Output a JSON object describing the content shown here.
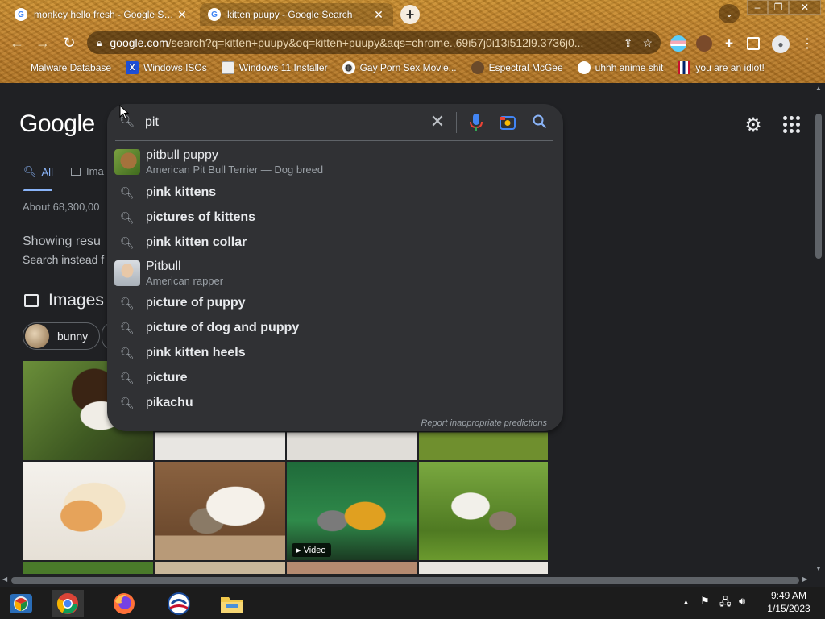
{
  "browser": {
    "tabs": [
      {
        "title": "monkey hello fresh - Google Search",
        "active": false
      },
      {
        "title": "kitten puupy - Google Search",
        "active": true
      }
    ],
    "url_host": "google.com",
    "url_rest": "/search?q=kitten+puupy&oq=kitten+puupy&aqs=chrome..69i57j0i13i512l9.3736j0...",
    "bookmarks": [
      {
        "label": "Malware Database",
        "icon": "none"
      },
      {
        "label": "Windows ISOs",
        "icon": "x-logo"
      },
      {
        "label": "Windows 11 Installer",
        "icon": "picture"
      },
      {
        "label": "Gay Porn Sex Movie...",
        "icon": "globe"
      },
      {
        "label": "Espectral McGee",
        "icon": "avatar"
      },
      {
        "label": "uhhh anime shit",
        "icon": "avatar"
      },
      {
        "label": "you are an idiot!",
        "icon": "flag"
      }
    ]
  },
  "page": {
    "logo": "Google",
    "tabs": {
      "all": "All",
      "images": "Ima"
    },
    "results_count": "About 68,300,00",
    "showing": "Showing resu",
    "search_instead": "Search instead f",
    "images_heading": "Images",
    "chip": "bunny",
    "video_label": "Video"
  },
  "search": {
    "value": "pit",
    "report_link": "Report inappropriate predictions",
    "suggestions": [
      {
        "kind": "entity",
        "title": "pitbull puppy",
        "subtitle": "American Pit Bull Terrier — Dog breed"
      },
      {
        "kind": "query",
        "typed": "pi",
        "rest": "nk kittens"
      },
      {
        "kind": "query",
        "typed": "pi",
        "rest": "ctures of kittens"
      },
      {
        "kind": "query",
        "typed": "pi",
        "rest": "nk kitten collar"
      },
      {
        "kind": "entity",
        "title": "Pitbull",
        "subtitle": "American rapper"
      },
      {
        "kind": "query",
        "typed": "pi",
        "rest": "cture of puppy"
      },
      {
        "kind": "query",
        "typed": "pi",
        "rest": "cture of dog and puppy"
      },
      {
        "kind": "query",
        "typed": "pi",
        "rest": "nk kitten heels"
      },
      {
        "kind": "query",
        "typed": "pi",
        "rest": "cture"
      },
      {
        "kind": "query",
        "typed": "pi",
        "rest": "kachu"
      }
    ]
  },
  "taskbar": {
    "time": "9:49 AM",
    "date": "1/15/2023"
  },
  "colors": {
    "accent_blue": "#8ab4f8",
    "page_bg": "#202124",
    "dropdown_bg": "#303134"
  }
}
